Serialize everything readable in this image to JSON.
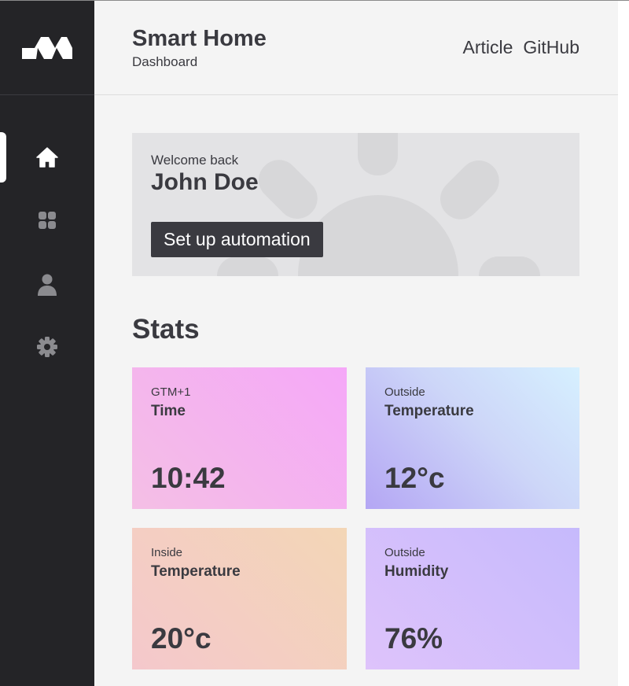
{
  "header": {
    "title": "Smart Home",
    "subtitle": "Dashboard",
    "links": [
      "Article",
      "GitHub"
    ]
  },
  "sidebar": {
    "logo": "brand-logo",
    "items": [
      {
        "name": "home",
        "icon": "home-icon",
        "active": true
      },
      {
        "name": "apps",
        "icon": "grid-icon",
        "active": false
      },
      {
        "name": "profile",
        "icon": "user-icon",
        "active": false
      },
      {
        "name": "settings",
        "icon": "gear-icon",
        "active": false
      }
    ]
  },
  "welcome": {
    "greeting": "Welcome back",
    "name": "John Doe",
    "button": "Set up automation",
    "decoration": "sun-icon"
  },
  "stats": {
    "title": "Stats",
    "cards": [
      {
        "label": "GTM+1",
        "title": "Time",
        "value": "10:42"
      },
      {
        "label": "Outside",
        "title": "Temperature",
        "value": "12°c"
      },
      {
        "label": "Inside",
        "title": "Temperature",
        "value": "20°c"
      },
      {
        "label": "Outside",
        "title": "Humidity",
        "value": "76%"
      }
    ]
  },
  "colors": {
    "sidebar": "#242427",
    "background": "#f4f4f4",
    "text": "#3a3a40",
    "button": "#3a3a40"
  }
}
